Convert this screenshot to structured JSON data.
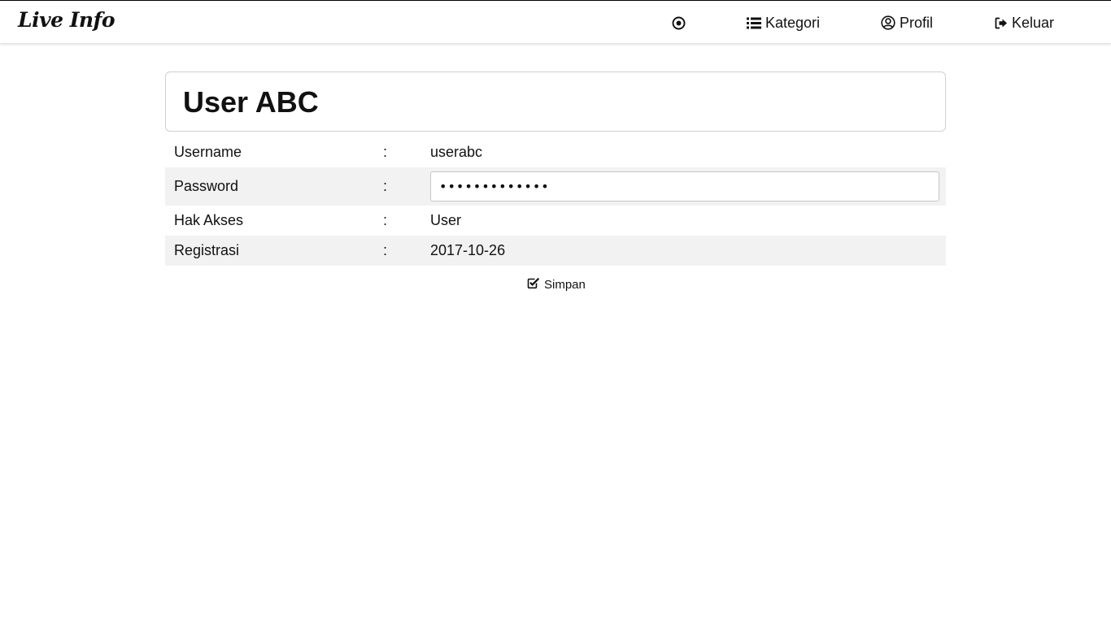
{
  "header": {
    "brand": "Live Info",
    "nav": {
      "kategori": "Kategori",
      "profil": "Profil",
      "keluar": "Keluar"
    }
  },
  "profile": {
    "title": "User ABC",
    "rows": [
      {
        "label": "Username",
        "separator": ":",
        "value": "userabc"
      },
      {
        "label": "Password",
        "separator": ":",
        "value": "•••••••••••••"
      },
      {
        "label": "Hak Akses",
        "separator": ":",
        "value": "User"
      },
      {
        "label": "Registrasi",
        "separator": ":",
        "value": "2017-10-26"
      }
    ]
  },
  "actions": {
    "save_label": "Simpan"
  },
  "icons": {
    "target": "bullseye-icon",
    "kategori": "list-icon",
    "profil": "user-circle-icon",
    "keluar": "sign-out-icon",
    "save": "check-square-icon"
  }
}
